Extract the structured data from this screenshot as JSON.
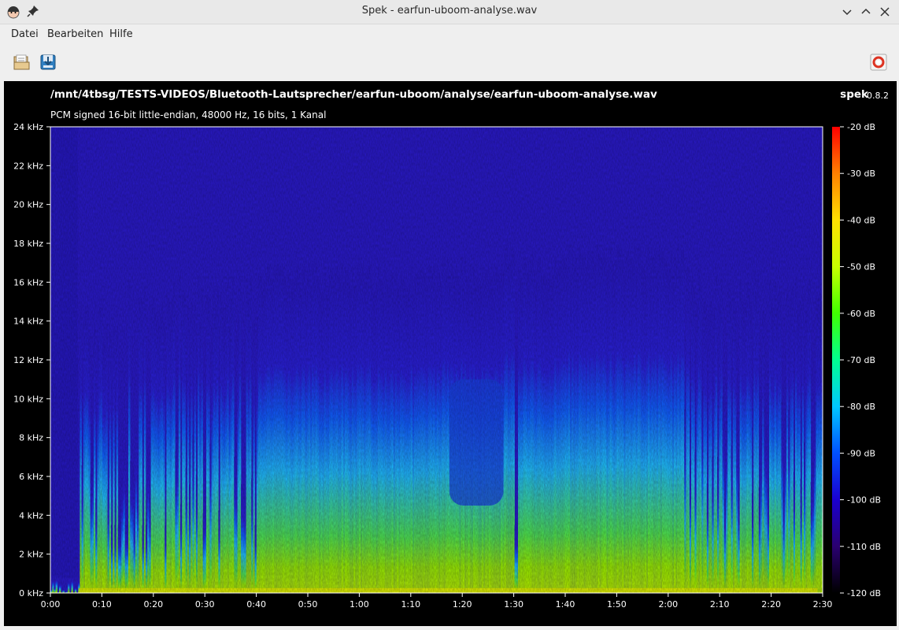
{
  "window": {
    "title": "Spek - earfun-uboom-analyse.wav"
  },
  "menu": {
    "items": [
      "Datei",
      "Bearbeiten",
      "Hilfe"
    ]
  },
  "toolbar": {
    "open_icon": "folder-open-icon",
    "save_icon": "save-icon",
    "help_icon": "lifebuoy-icon"
  },
  "spek": {
    "file_path": "/mnt/4tbsg/TESTS-VIDEOS/Bluetooth-Lautsprecher/earfun-uboom/analyse/earfun-uboom-analyse.wav",
    "format_info": "PCM signed 16-bit little-endian, 48000 Hz, 16 bits, 1 Kanal",
    "logo": "spek",
    "version": "0.8.2"
  },
  "chart_data": {
    "type": "heatmap",
    "title": "",
    "xlabel": "",
    "ylabel": "",
    "x_ticks": [
      "0:00",
      "0:10",
      "0:20",
      "0:30",
      "0:40",
      "0:50",
      "1:00",
      "1:10",
      "1:20",
      "1:30",
      "1:40",
      "1:50",
      "2:00",
      "2:10",
      "2:20",
      "2:30"
    ],
    "y_ticks": [
      "0 kHz",
      "2 kHz",
      "4 kHz",
      "6 kHz",
      "8 kHz",
      "10 kHz",
      "12 kHz",
      "14 kHz",
      "16 kHz",
      "18 kHz",
      "20 kHz",
      "22 kHz",
      "24 kHz"
    ],
    "xlim_seconds": [
      0,
      150
    ],
    "ylim_khz": [
      0,
      24
    ],
    "colorbar_ticks": [
      "-20 dB",
      "-30 dB",
      "-40 dB",
      "-50 dB",
      "-60 dB",
      "-70 dB",
      "-80 dB",
      "-90 dB",
      "-100 dB",
      "-110 dB",
      "-120 dB"
    ],
    "colorbar_range_db": [
      -120,
      -20
    ],
    "colorbar_colors": [
      "#000000",
      "#2a0070",
      "#1a00d0",
      "#0050ff",
      "#00c8ff",
      "#00ff90",
      "#40ff00",
      "#c8ff00",
      "#ffe000",
      "#ff8000",
      "#ff0000"
    ]
  }
}
